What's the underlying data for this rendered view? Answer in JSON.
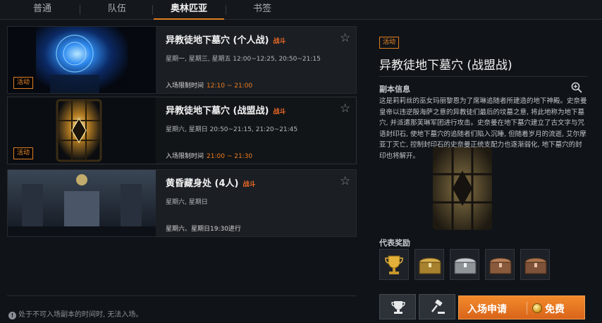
{
  "tabs": [
    {
      "label": "普通",
      "active": false
    },
    {
      "label": "队伍",
      "active": false
    },
    {
      "label": "奥林匹亚",
      "active": true
    },
    {
      "label": "书签",
      "active": false
    }
  ],
  "dungeons": [
    {
      "title": "异教徒地下墓穴 (个人战)",
      "tag": "战斗",
      "days": "星期一, 星期三, 星期五  12:00~12:25, 20:50~21:15",
      "limit_label": "入场限制时间",
      "limit_time": "12:10 ~ 21:00",
      "badge": "活动"
    },
    {
      "title": "异教徒地下墓穴 (战盟战)",
      "tag": "战斗",
      "days": "星期六, 星期日  20:50~21:15, 21:20~21:45",
      "limit_label": "入场限制时间",
      "limit_time": "21:00 ~ 21:30",
      "badge": "活动"
    },
    {
      "title": "黄昏藏身处 (4人)",
      "tag": "战斗",
      "days": "星期六, 星期日",
      "limit_label": "星期六、星期日19:30进行",
      "limit_time": "",
      "badge": ""
    }
  ],
  "notice": "处于不可入场副本的时间时, 无法入场。",
  "detail": {
    "badge": "活动",
    "title": "异教徒地下墓穴 (战盟战)",
    "section_info": "副本信息",
    "description": "这是莉莉丝的巫女玛丽黎恩为了席琳追随者所建造的地下神殿。史奈曼皇帝以违逆殷海萨之意的异教徒们最后的坟墓之意, 将此地称为地下墓穴, 并派遣那芙琳军团进行攻击。史奈曼在地下墓穴建立了古文字与咒语封印石, 使地下墓穴的追随者们陷入沉睡, 但随着岁月的流逝, 艾尔摩亚丁灭亡, 控制封印石的史奈曼正统支配力也逐渐弱化, 地下墓穴的封印也将解开。",
    "section_rewards": "代表奖励",
    "rewards": [
      "trophy",
      "gold-chest",
      "silver-chest",
      "bronze-chest",
      "bronze-chest"
    ],
    "enter_label": "入场申请",
    "free_label": "免费"
  },
  "colors": {
    "accent": "#e07d20",
    "tag": "#ef6a25",
    "background": "#101418"
  }
}
